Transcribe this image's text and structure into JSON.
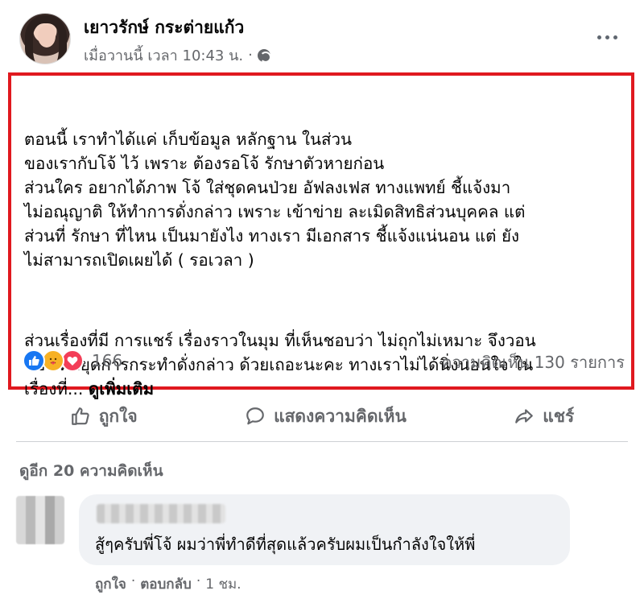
{
  "post": {
    "author": "เยาวรักษ์ กระต่ายแก้ว",
    "time": "เมื่อวานนี้ เวลา 10:43 น.",
    "separator": "·",
    "paragraph1": "ตอนนี้ เราทำได้แค่ เก็บข้อมูล หลักฐาน ในส่วน\nของเรากับโจ้ ไว้ เพราะ ต้องรอโจ้ รักษาตัวหายก่อน\nส่วนใคร อยากได้ภาพ โจ้ ใส่ชุดคนป่วย อัฟลงเฟส ทางแพทย์ ชี้แจ้งมา\nไม่อณุญาติ ให้ทำการดั่งกล่าว เพราะ เข้าข่าย ละเมิดสิทธิส่วนบุคคล แต่\nส่วนที่ รักษา ที่ไหน เป็นมายังไง ทางเรา มีเอกสาร ชี้แจ้งแน่นอน แต่ ยัง\nไม่สามารถเปิดเผยได้ ( รอเวลา )",
    "paragraph2": "ส่วนเรื่องที่มี การแชร์ เรื่องราวในมุม ที่เห็นชอบว่า ไม่ถุกไม่เหมาะ จึงวอน\nขอ ให้หยุดการกระทำดั่งกล่าว ด้วยเถอะนะคะ ทางเราไม่ได้นิ่งนอนใจ ใน\nเรื่องที่... ",
    "see_more": "ดูเพิ่มเติม"
  },
  "reactions": {
    "icons": [
      "like-icon",
      "care-icon",
      "love-icon"
    ],
    "count": "166",
    "comments": "ความคิดเห็น 130 รายการ"
  },
  "actions": {
    "like": "ถูกใจ",
    "comment": "แสดงความคิดเห็น",
    "share": "แชร์"
  },
  "view_more_comments": "ดูอีก 20 ความคิดเห็น",
  "comment": {
    "text": "สู้ๆครับพี่โจ้ ผมว่าพี่ทำดีที่สุดแล้วครับผมเป็นกำลังใจให้พี่",
    "like": "ถูกใจ",
    "reply": "ตอบกลับ",
    "time": "1 ชม.",
    "dot": "·"
  },
  "colors": {
    "highlight": "#e0191f",
    "like_blue": "#1877f2",
    "love_red": "#f33e58",
    "care_yellow": "#f7b125",
    "secondary_text": "#65676b"
  }
}
